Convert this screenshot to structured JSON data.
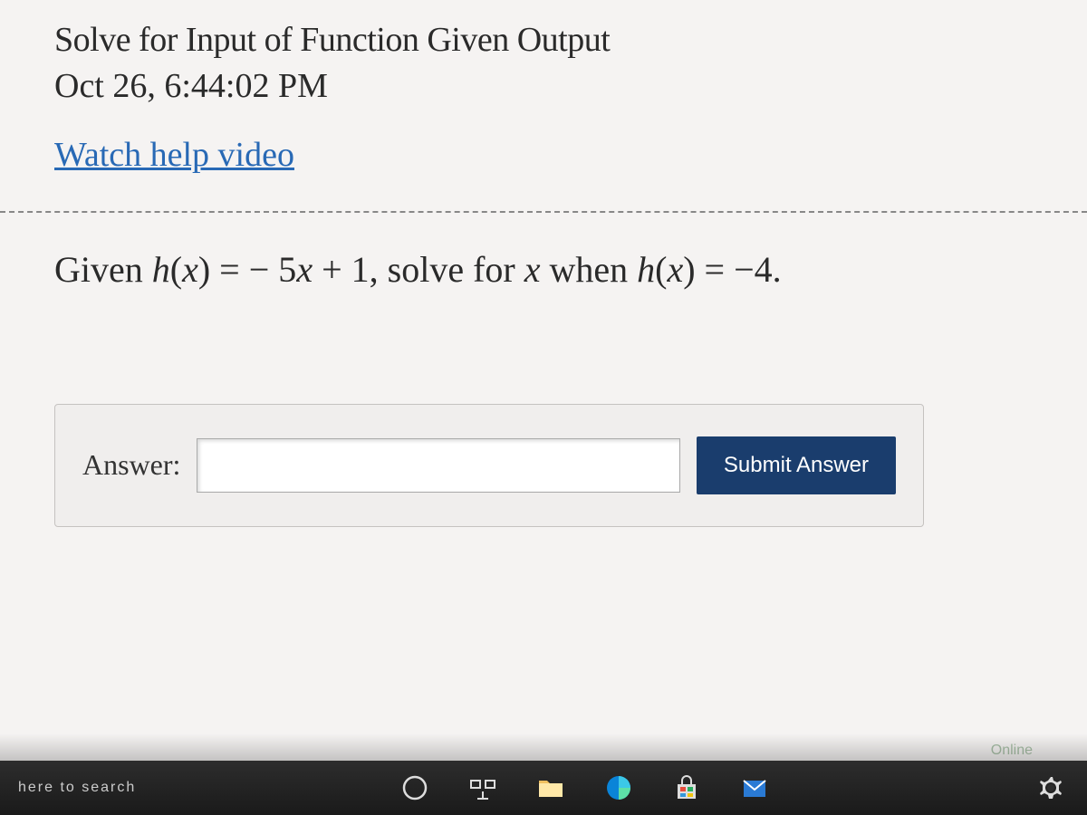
{
  "page": {
    "title": "Solve for Input of Function Given Output",
    "timestamp": "Oct 26, 6:44:02 PM"
  },
  "help": {
    "link_text": "Watch help video"
  },
  "problem": {
    "prefix": "Given ",
    "func": "h",
    "var": "x",
    "rhs": "− 5",
    "plus_one": " + 1",
    "solve_text": ", solve for ",
    "when_text": " when ",
    "value": " = −4."
  },
  "answer": {
    "label": "Answer:",
    "submit_label": "Submit Answer",
    "input_value": ""
  },
  "taskbar": {
    "search_partial": "here to search",
    "online_text": "Online"
  }
}
